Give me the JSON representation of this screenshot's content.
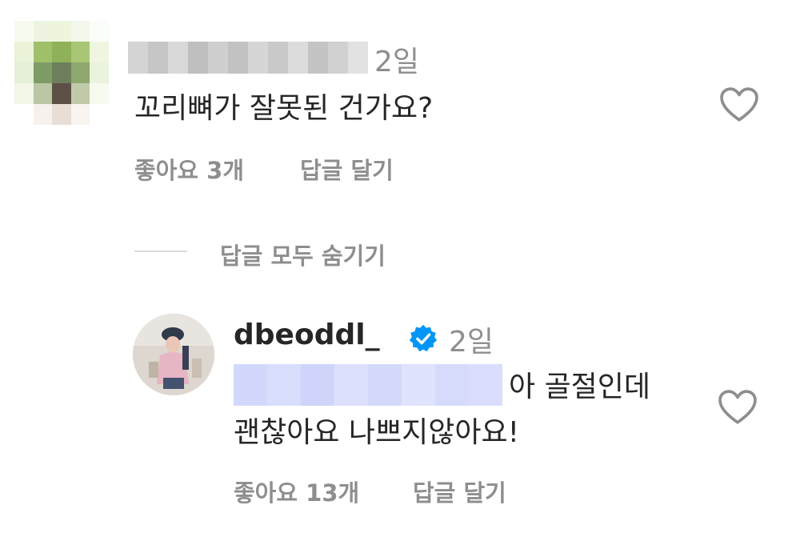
{
  "comment": {
    "time": "2일",
    "text": "꼬리뼈가 잘못된 건가요?",
    "likes_label": "좋아요 3개",
    "reply_label": "답글 달기",
    "hide_replies_label": "답글 모두 숨기기"
  },
  "reply": {
    "username": "dbeoddl_",
    "verified_icon": "verified-badge-icon",
    "time": "2일",
    "text_line_1": "아 골절인데",
    "text_line_2": "괜찮아요 나쁘지않아요!",
    "likes_label": "좋아요 13개",
    "reply_label": "답글 달기"
  },
  "colors": {
    "primary_text": "#262626",
    "secondary_text": "#8e8e8e",
    "verified_blue": "#0095f6",
    "blur_mention": "#d7dcfb"
  }
}
